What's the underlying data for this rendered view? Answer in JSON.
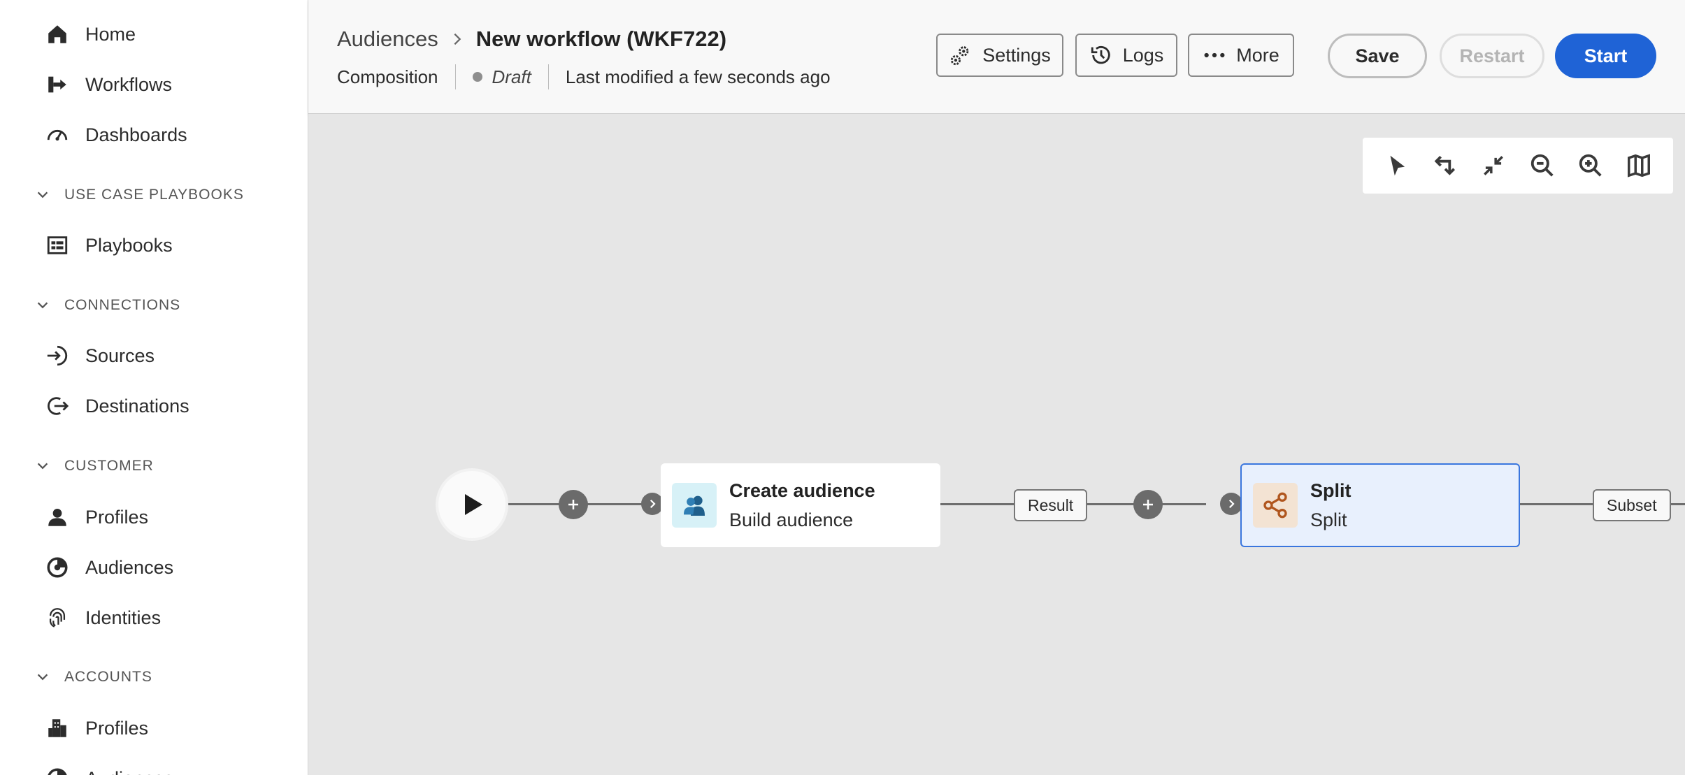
{
  "sidebar": {
    "items": [
      {
        "label": "Home",
        "icon": "home-icon"
      },
      {
        "label": "Workflows",
        "icon": "workflow-icon"
      },
      {
        "label": "Dashboards",
        "icon": "gauge-icon"
      }
    ],
    "sections": [
      {
        "label": "USE CASE PLAYBOOKS",
        "items": [
          {
            "label": "Playbooks",
            "icon": "playbook-icon"
          }
        ]
      },
      {
        "label": "CONNECTIONS",
        "items": [
          {
            "label": "Sources",
            "icon": "source-icon"
          },
          {
            "label": "Destinations",
            "icon": "destination-icon"
          }
        ]
      },
      {
        "label": "CUSTOMER",
        "items": [
          {
            "label": "Profiles",
            "icon": "person-icon"
          },
          {
            "label": "Audiences",
            "icon": "audience-icon"
          },
          {
            "label": "Identities",
            "icon": "fingerprint-icon"
          }
        ]
      },
      {
        "label": "ACCOUNTS",
        "items": [
          {
            "label": "Profiles",
            "icon": "building-icon"
          },
          {
            "label": "Audiences",
            "icon": "audience-icon"
          }
        ]
      }
    ]
  },
  "header": {
    "breadcrumb_parent": "Audiences",
    "title": "New workflow (WKF722)",
    "composition": "Composition",
    "status": "Draft",
    "last_modified": "Last modified a few seconds ago",
    "buttons": {
      "settings": "Settings",
      "logs": "Logs",
      "more": "More",
      "save": "Save",
      "restart": "Restart",
      "start": "Start"
    }
  },
  "canvas": {
    "toolbar": [
      "select-tool-icon",
      "undo-redo-icon",
      "fit-to-screen-icon",
      "zoom-out-icon",
      "zoom-in-icon",
      "minimap-icon"
    ],
    "nodes": [
      {
        "title": "Create audience",
        "subtitle": "Build audience",
        "icon": "audience-build-icon"
      },
      {
        "title": "Split",
        "subtitle": "Split",
        "icon": "split-icon"
      }
    ],
    "output_tags": [
      "Result",
      "Subset"
    ]
  },
  "colors": {
    "accent": "#1f63d6",
    "selected_node_bg": "#e8f0fd",
    "selected_node_border": "#3a76de",
    "create_icon_bg": "#d7f1f7",
    "split_icon_bg": "#f3e3d3"
  }
}
